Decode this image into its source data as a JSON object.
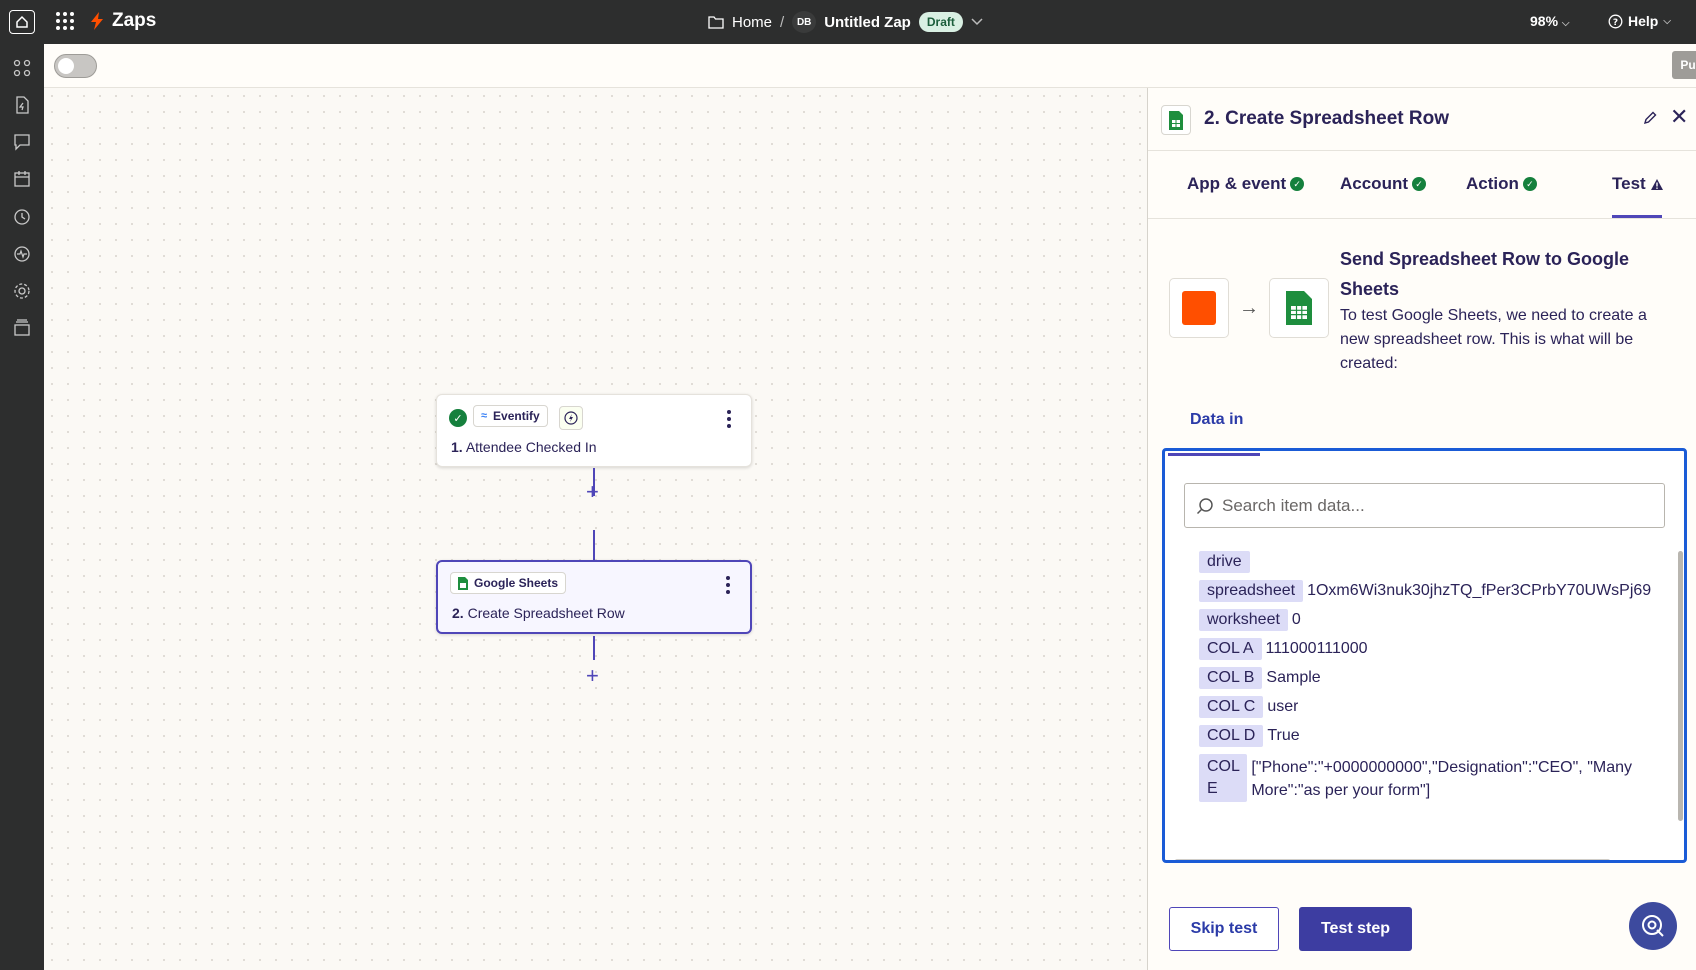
{
  "topbar": {
    "app_title": "Zaps",
    "breadcrumb_home": "Home",
    "breadcrumb_sep": "/",
    "owner_initials": "DB",
    "zap_name": "Untitled Zap",
    "status_badge": "Draft",
    "zoom_level": "98%",
    "help_label": "Help"
  },
  "toolbar": {
    "publish_label": "Publish"
  },
  "canvas": {
    "step1": {
      "app_name": "Eventify",
      "number": "1.",
      "title": "Attendee Checked In"
    },
    "step2": {
      "app_name": "Google Sheets",
      "number": "2.",
      "title": "Create Spreadsheet Row"
    },
    "add_symbol": "+"
  },
  "panel": {
    "title": "2. Create Spreadsheet Row",
    "tabs": [
      {
        "label": "App & event",
        "status": "complete"
      },
      {
        "label": "Account",
        "status": "complete"
      },
      {
        "label": "Action",
        "status": "complete"
      },
      {
        "label": "Test",
        "status": "warning"
      }
    ],
    "summary_title": "Send Spreadsheet Row to Google Sheets",
    "summary_desc": "To test Google Sheets, we need to create a new spreadsheet row. This is what will be created:",
    "data_in_label": "Data in",
    "search_placeholder": "Search item data...",
    "data_rows": [
      {
        "key": "drive",
        "value": ""
      },
      {
        "key": "spreadsheet",
        "value": "1Oxm6Wi3nuk30jhzTQ_fPer3CPrbY70UWsPj69"
      },
      {
        "key": "worksheet",
        "value": "0"
      },
      {
        "key": "COL A",
        "value": "111000111000"
      },
      {
        "key": "COL B",
        "value": "Sample"
      },
      {
        "key": "COL C",
        "value": "user"
      },
      {
        "key": "COL D",
        "value": "True"
      },
      {
        "key": "COL E",
        "value": "[\"Phone\":\"+0000000000\",\"Designation\":\"CEO\", \"Many More\":\"as per your form\"]"
      }
    ],
    "skip_label": "Skip test",
    "test_label": "Test step"
  },
  "colors": {
    "accent": "#4f46b8",
    "brand_orange": "#ff4f00",
    "success": "#15803d",
    "sheets_green": "#1e8e3e"
  }
}
